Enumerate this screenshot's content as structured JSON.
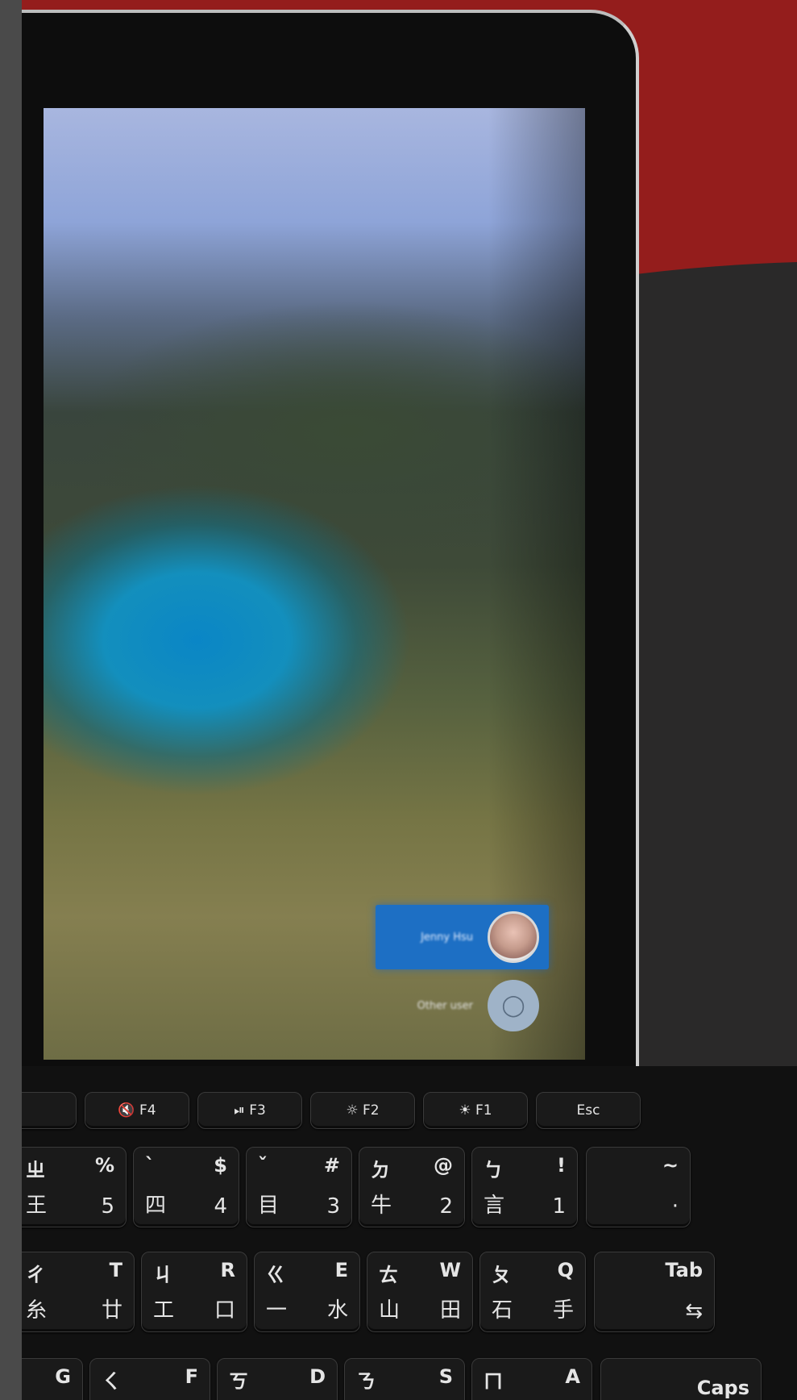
{
  "login": {
    "user_name": "Jenny Hsu",
    "other_user_label": "Other user"
  },
  "keyboard": {
    "function_row": [
      {
        "label": "Esc"
      },
      {
        "label": "☀ F1"
      },
      {
        "label": "☼ F2"
      },
      {
        "label": "⏯ F3"
      },
      {
        "label": "🔇 F4"
      }
    ],
    "number_row": [
      {
        "top": "~",
        "bottom": "·"
      },
      {
        "top": "!",
        "top2": "ㄅ",
        "bottom": "1",
        "bottom2": "言"
      },
      {
        "top": "@",
        "top2": "ㄉ",
        "bottom": "2",
        "bottom2": "牛"
      },
      {
        "top": "#",
        "top2": "ˇ",
        "bottom": "3",
        "bottom2": "目"
      },
      {
        "top": "$",
        "top2": "ˋ",
        "bottom": "4",
        "bottom2": "四"
      },
      {
        "top": "%",
        "top2": "ㄓ",
        "bottom": "5",
        "bottom2": "王"
      }
    ],
    "letter_row": [
      {
        "label": "Tab"
      },
      {
        "top": "Q",
        "top2": "ㄆ",
        "bottom": "手",
        "bottom2": "石"
      },
      {
        "top": "W",
        "top2": "ㄊ",
        "bottom": "田",
        "bottom2": "山"
      },
      {
        "top": "E",
        "top2": "ㄍ",
        "bottom": "水",
        "bottom2": "一"
      },
      {
        "top": "R",
        "top2": "ㄐ",
        "bottom": "口",
        "bottom2": "工"
      },
      {
        "top": "T",
        "top2": "ㄔ",
        "bottom": "廿",
        "bottom2": "糸"
      }
    ],
    "home_row": [
      {
        "label": "Caps"
      },
      {
        "top": "A",
        "top2": "ㄇ"
      },
      {
        "top": "S",
        "top2": "ㄋ"
      },
      {
        "top": "D",
        "top2": "ㄎ"
      },
      {
        "top": "F",
        "top2": "ㄑ"
      },
      {
        "top": "G"
      }
    ]
  },
  "colors": {
    "background_red": "#941d1c",
    "background_dark": "#2a2929",
    "selected_user": "#1d6fc4"
  }
}
